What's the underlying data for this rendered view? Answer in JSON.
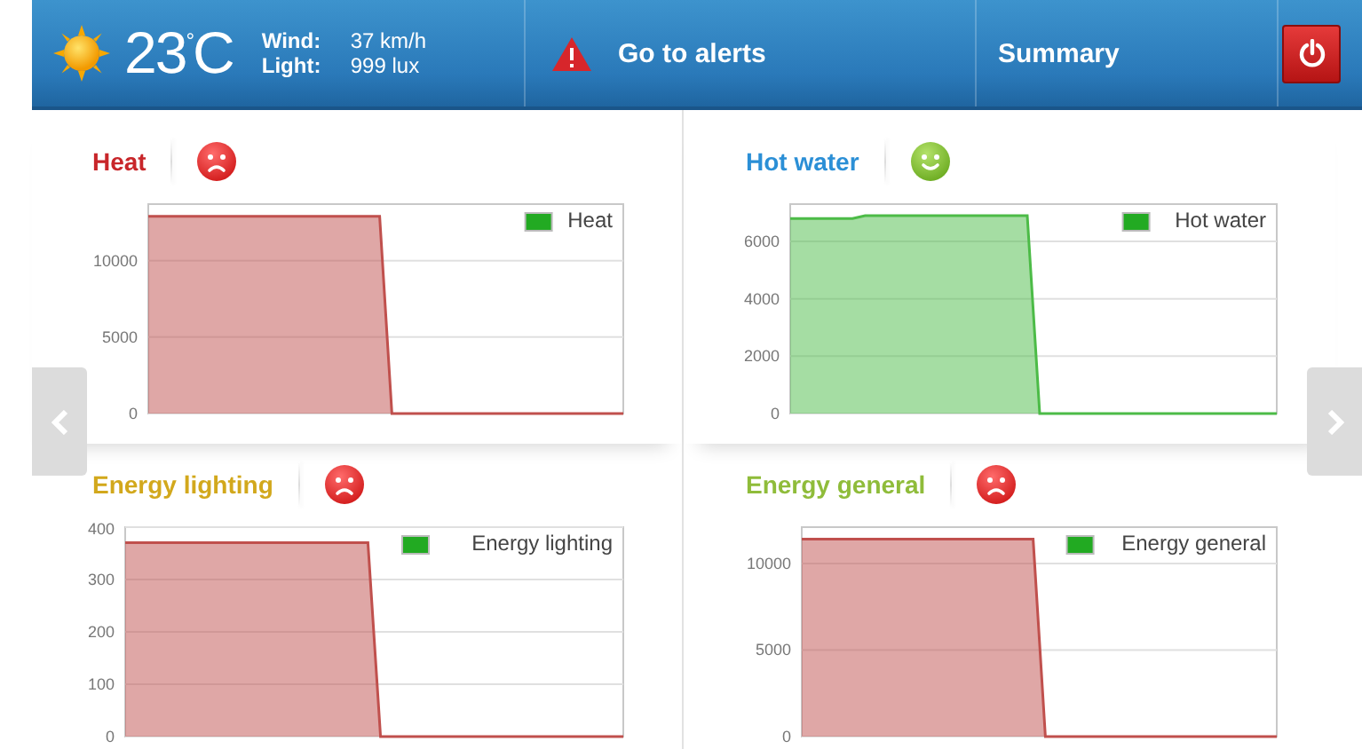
{
  "header": {
    "weather": {
      "temperature": "23$^{°}$C",
      "readings": [
        {
          "label": "Wind:",
          "value": "37 km/h"
        },
        {
          "label": "Light:",
          "value": "999 lux"
        }
      ]
    },
    "alerts_button": {
      "label": "Go to alerts"
    },
    "summary_button": {
      "label": "Summary"
    }
  },
  "panels": [
    {
      "title": "Heat",
      "color": "#c8262a",
      "happy": false,
      "chart_data": {
        "type": "area",
        "grid": true,
        "categories": [
          null,
          null,
          null,
          null,
          null,
          null,
          null,
          null,
          null,
          null,
          null,
          null,
          null,
          null,
          null,
          null,
          null,
          null,
          null,
          null,
          null,
          null,
          null,
          null,
          null,
          null,
          null,
          null,
          null,
          null,
          null,
          null,
          null,
          null,
          null,
          null,
          null,
          null,
          null,
          null
        ],
        "series": [
          {
            "name": "Heat",
            "color": "#c0504d",
            "values": [
              12900,
              12900,
              12900,
              12900,
              12900,
              12900,
              12900,
              12900,
              12900,
              12900,
              12900,
              12900,
              12900,
              12900,
              12900,
              12900,
              12900,
              12900,
              12900,
              12900,
              0,
              0,
              0,
              0,
              0,
              0,
              0,
              0,
              0,
              0,
              0,
              0,
              0,
              0,
              0,
              0,
              0,
              0,
              0,
              0
            ]
          }
        ],
        "ylim": [
          0,
          13700
        ],
        "yticks": [
          0,
          5000,
          10000
        ]
      }
    },
    {
      "title": "Hot water",
      "color": "#2b8fd6",
      "happy": true,
      "chart_data": {
        "type": "area",
        "grid": true,
        "categories": [
          null,
          null,
          null,
          null,
          null,
          null,
          null,
          null,
          null,
          null,
          null,
          null,
          null,
          null,
          null,
          null,
          null,
          null,
          null,
          null,
          null,
          null,
          null,
          null,
          null,
          null,
          null,
          null,
          null,
          null,
          null,
          null,
          null,
          null,
          null,
          null,
          null,
          null,
          null,
          null
        ],
        "series": [
          {
            "name": "Hot water",
            "color": "#4cbb47",
            "values": [
              6800,
              6800,
              6800,
              6800,
              6800,
              6800,
              6900,
              6900,
              6900,
              6900,
              6900,
              6900,
              6900,
              6900,
              6900,
              6900,
              6900,
              6900,
              6900,
              6900,
              0,
              0,
              0,
              0,
              0,
              0,
              0,
              0,
              0,
              0,
              0,
              0,
              0,
              0,
              0,
              0,
              0,
              0,
              0,
              0
            ]
          }
        ],
        "ylim": [
          0,
          7300
        ],
        "yticks": [
          0,
          2000,
          4000,
          6000
        ]
      }
    },
    {
      "title": "Energy lighting",
      "color": "#d2a81c",
      "happy": false,
      "chart_data": {
        "type": "area",
        "grid": true,
        "categories": [
          null,
          null,
          null,
          null,
          null,
          null,
          null,
          null,
          null,
          null,
          null,
          null,
          null,
          null,
          null,
          null,
          null,
          null,
          null,
          null,
          null,
          null,
          null,
          null,
          null,
          null,
          null,
          null,
          null,
          null,
          null,
          null,
          null,
          null,
          null,
          null,
          null,
          null,
          null,
          null
        ],
        "series": [
          {
            "name": "Energy lighting",
            "color": "#c0504d",
            "values": [
              370,
              370,
              370,
              370,
              370,
              370,
              370,
              370,
              370,
              370,
              370,
              370,
              370,
              370,
              370,
              370,
              370,
              370,
              370,
              370,
              0,
              0,
              0,
              0,
              0,
              0,
              0,
              0,
              0,
              0,
              0,
              0,
              0,
              0,
              0,
              0,
              0,
              0,
              0,
              0
            ]
          }
        ],
        "ylim": [
          0,
          400
        ],
        "yticks": [
          0,
          100,
          200,
          300,
          400
        ]
      }
    },
    {
      "title": "Energy general",
      "color": "#8fbc3a",
      "happy": false,
      "chart_data": {
        "type": "area",
        "grid": true,
        "categories": [
          null,
          null,
          null,
          null,
          null,
          null,
          null,
          null,
          null,
          null,
          null,
          null,
          null,
          null,
          null,
          null,
          null,
          null,
          null,
          null,
          null,
          null,
          null,
          null,
          null,
          null,
          null,
          null,
          null,
          null,
          null,
          null,
          null,
          null,
          null,
          null,
          null,
          null,
          null,
          null
        ],
        "series": [
          {
            "name": "Energy general",
            "color": "#c0504d",
            "values": [
              11400,
              11400,
              11400,
              11400,
              11400,
              11400,
              11400,
              11400,
              11400,
              11400,
              11400,
              11400,
              11400,
              11400,
              11400,
              11400,
              11400,
              11400,
              11400,
              11400,
              0,
              0,
              0,
              0,
              0,
              0,
              0,
              0,
              0,
              0,
              0,
              0,
              0,
              0,
              0,
              0,
              0,
              0,
              0,
              0
            ]
          }
        ],
        "ylim": [
          0,
          12100
        ],
        "yticks": [
          0,
          5000,
          10000
        ]
      }
    }
  ]
}
